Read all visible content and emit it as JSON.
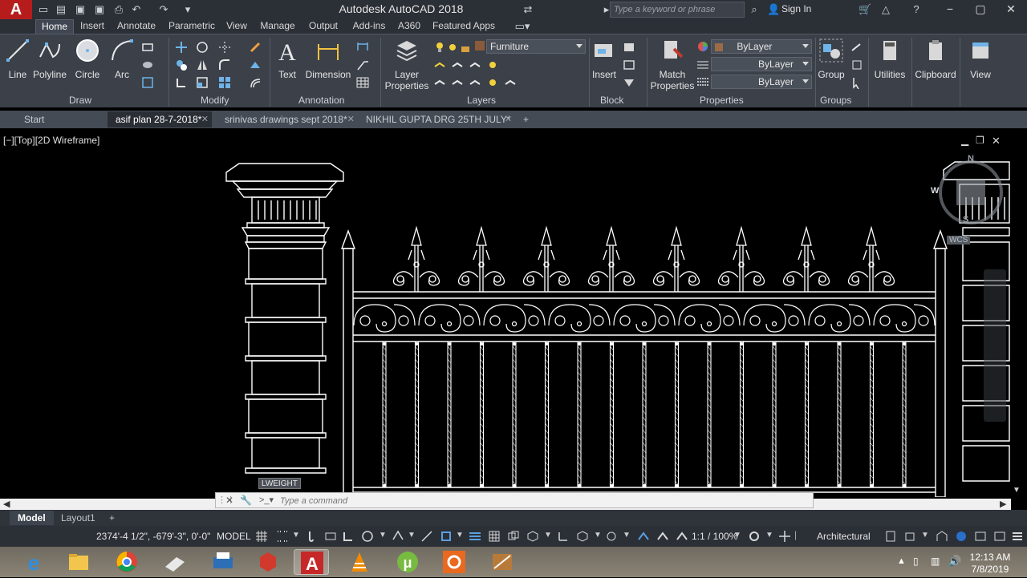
{
  "app": {
    "title": "Autodesk AutoCAD 2018",
    "logo_letter": "A",
    "search_placeholder": "Type a keyword or phrase",
    "sign_in": "Sign In"
  },
  "ribbon_tabs": [
    "Home",
    "Insert",
    "Annotate",
    "Parametric",
    "View",
    "Manage",
    "Output",
    "Add-ins",
    "A360",
    "Featured Apps"
  ],
  "active_ribbon_tab": "Home",
  "ribbon": {
    "draw": {
      "label": "Draw",
      "tools": [
        "Line",
        "Polyline",
        "Circle",
        "Arc"
      ]
    },
    "modify": {
      "label": "Modify"
    },
    "annotation": {
      "label": "Annotation",
      "tools": [
        "Text",
        "Dimension"
      ]
    },
    "layers": {
      "label": "Layers",
      "tool": "Layer Properties",
      "current_layer": "Furniture"
    },
    "block": {
      "label": "Block",
      "tool": "Insert"
    },
    "properties": {
      "label": "Properties",
      "tool": "Match Properties",
      "color": "ByLayer",
      "linetype": "ByLayer",
      "lineweight": "ByLayer"
    },
    "groups": {
      "label": "Groups",
      "tool": "Group"
    },
    "utilities": "Utilities",
    "clipboard": "Clipboard",
    "view": "View"
  },
  "doc_tabs": [
    {
      "label": "Start",
      "closable": false
    },
    {
      "label": "asif plan 28-7-2018*",
      "closable": true,
      "active": true
    },
    {
      "label": "srinivas drawings sept 2018*",
      "closable": true
    },
    {
      "label": "NIKHIL GUPTA DRG 25TH JULY*",
      "closable": true
    }
  ],
  "viewport": {
    "label": "[−][Top][2D Wireframe]",
    "tooltip": "LWEIGHT",
    "viewcube": {
      "north": "N",
      "west": "W",
      "south": "S",
      "wcs": "WCS"
    }
  },
  "command_line": {
    "placeholder": "Type a command"
  },
  "layout_tabs": [
    {
      "label": "Model",
      "active": true
    },
    {
      "label": "Layout1",
      "active": false
    }
  ],
  "status": {
    "coordinates": "2374'-4 1/2\", -679'-3\", 0'-0\"",
    "space": "MODEL",
    "annotation_scale": "1:1 / 100%",
    "units": "Architectural"
  },
  "clock": {
    "time": "12:13 AM",
    "date": "7/8/2019"
  },
  "colors": {
    "title_bar": "#2b2f36",
    "ribbon": "#3b4049",
    "accent": "#b71c1c",
    "drawing_lines": "#ffffff"
  }
}
